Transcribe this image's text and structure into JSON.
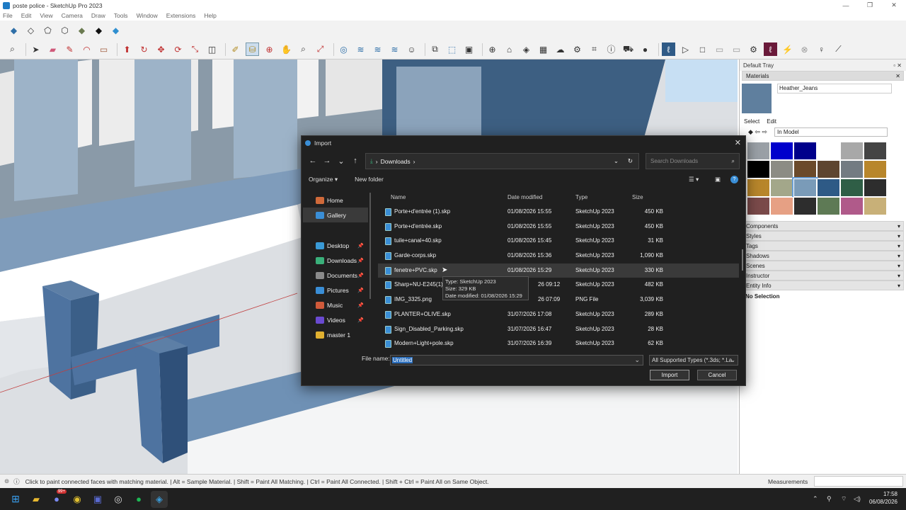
{
  "window": {
    "title": "poste police - SketchUp Pro 2023"
  },
  "menu": [
    "File",
    "Edit",
    "View",
    "Camera",
    "Draw",
    "Tools",
    "Window",
    "Extensions",
    "Help"
  ],
  "tray": {
    "title": "Default Tray",
    "materials_label": "Materials",
    "material_name": "Heather_Jeans",
    "tab_select": "Select",
    "tab_edit": "Edit",
    "collection": "In Model",
    "swatches": [
      "#9aa0a6",
      "#0000cc",
      "#00008b",
      "#ffffff",
      "#a8a8a8",
      "#444444",
      "#000000",
      "#8c8c84",
      "#6b4a2a",
      "#5e4530",
      "#737b82",
      "#b8862b",
      "#b8862b",
      "#a3a78a",
      "#7a9bb8",
      "#2e5a86",
      "#2f5e46",
      "#2d2d2d",
      "#7a4a4a",
      "#e6a084",
      "#2d2d2d",
      "#5e7a55",
      "#b05a8a",
      "#c8b078"
    ],
    "sections": [
      "Components",
      "Styles",
      "Tags",
      "Shadows",
      "Scenes",
      "Instructor",
      "Entity Info"
    ],
    "entity_status": "No Selection"
  },
  "dialog": {
    "title": "Import",
    "path": "Downloads",
    "search_placeholder": "Search Downloads",
    "organize": "Organize",
    "new_folder": "New folder",
    "nav": [
      {
        "label": "Home",
        "color": "#d06a3a",
        "pinned": false
      },
      {
        "label": "Gallery",
        "color": "#3a8ed6",
        "pinned": false
      },
      {
        "label": "Desktop",
        "color": "#3a9ad6",
        "pinned": true
      },
      {
        "label": "Downloads",
        "color": "#3ab07a",
        "pinned": true
      },
      {
        "label": "Documents",
        "color": "#8a8a8a",
        "pinned": true
      },
      {
        "label": "Pictures",
        "color": "#3a8ed6",
        "pinned": true
      },
      {
        "label": "Music",
        "color": "#d05a3a",
        "pinned": true
      },
      {
        "label": "Videos",
        "color": "#6a4ad0",
        "pinned": true
      },
      {
        "label": "master 1",
        "color": "#e0b030",
        "pinned": false
      }
    ],
    "columns": {
      "name": "Name",
      "date": "Date modified",
      "type": "Type",
      "size": "Size"
    },
    "files": [
      {
        "name": "Porte+d'entrée (1).skp",
        "date": "01/08/2026 15:55",
        "type": "SketchUp 2023",
        "size": "450 KB"
      },
      {
        "name": "Porte+d'entrée.skp",
        "date": "01/08/2026 15:55",
        "type": "SketchUp 2023",
        "size": "450 KB"
      },
      {
        "name": "tuile+canal+40.skp",
        "date": "01/08/2026 15:45",
        "type": "SketchUp 2023",
        "size": "31 KB"
      },
      {
        "name": "Garde-corps.skp",
        "date": "01/08/2026 15:36",
        "type": "SketchUp 2023",
        "size": "1,090 KB"
      },
      {
        "name": "fenetre+PVC.skp",
        "date": "01/08/2026 15:29",
        "type": "SketchUp 2023",
        "size": "330 KB"
      },
      {
        "name": "Sharp+NU-E245(1).",
        "date": "",
        "type": "SketchUp 2023",
        "size": "482 KB"
      },
      {
        "name": "IMG_3325.png",
        "date": "",
        "type": "PNG File",
        "size": "3,039 KB"
      },
      {
        "name": "PLANTER+OLIVE.skp",
        "date": "31/07/2026 17:08",
        "type": "SketchUp 2023",
        "size": "289 KB"
      },
      {
        "name": "Sign_Disabled_Parking.skp",
        "date": "31/07/2026 16:47",
        "type": "SketchUp 2023",
        "size": "28 KB"
      },
      {
        "name": "Modern+Light+pole.skp",
        "date": "31/07/2026 16:39",
        "type": "SketchUp 2023",
        "size": "62 KB"
      }
    ],
    "partial_dates": [
      "26 09:12",
      "26 07:09"
    ],
    "tooltip": {
      "type": "Type: SketchUp 2023",
      "size": "Size: 329 KB",
      "date": "Date modified: 01/08/2026 15:29"
    },
    "filename_label": "File name:",
    "filename_value": "Untitled",
    "filetype": "All Supported Types (*.3ds; *.La",
    "import_button": "Import",
    "cancel_button": "Cancel"
  },
  "status": {
    "hint": "Click to paint connected faces with matching material. | Alt = Sample Material. | Shift = Paint All Matching. | Ctrl = Paint All Connected. | Shift + Ctrl = Paint All on Same Object.",
    "measurements": "Measurements"
  },
  "taskbar": {
    "time": "17:58",
    "date": "06/08/2026",
    "badge": "99+"
  }
}
